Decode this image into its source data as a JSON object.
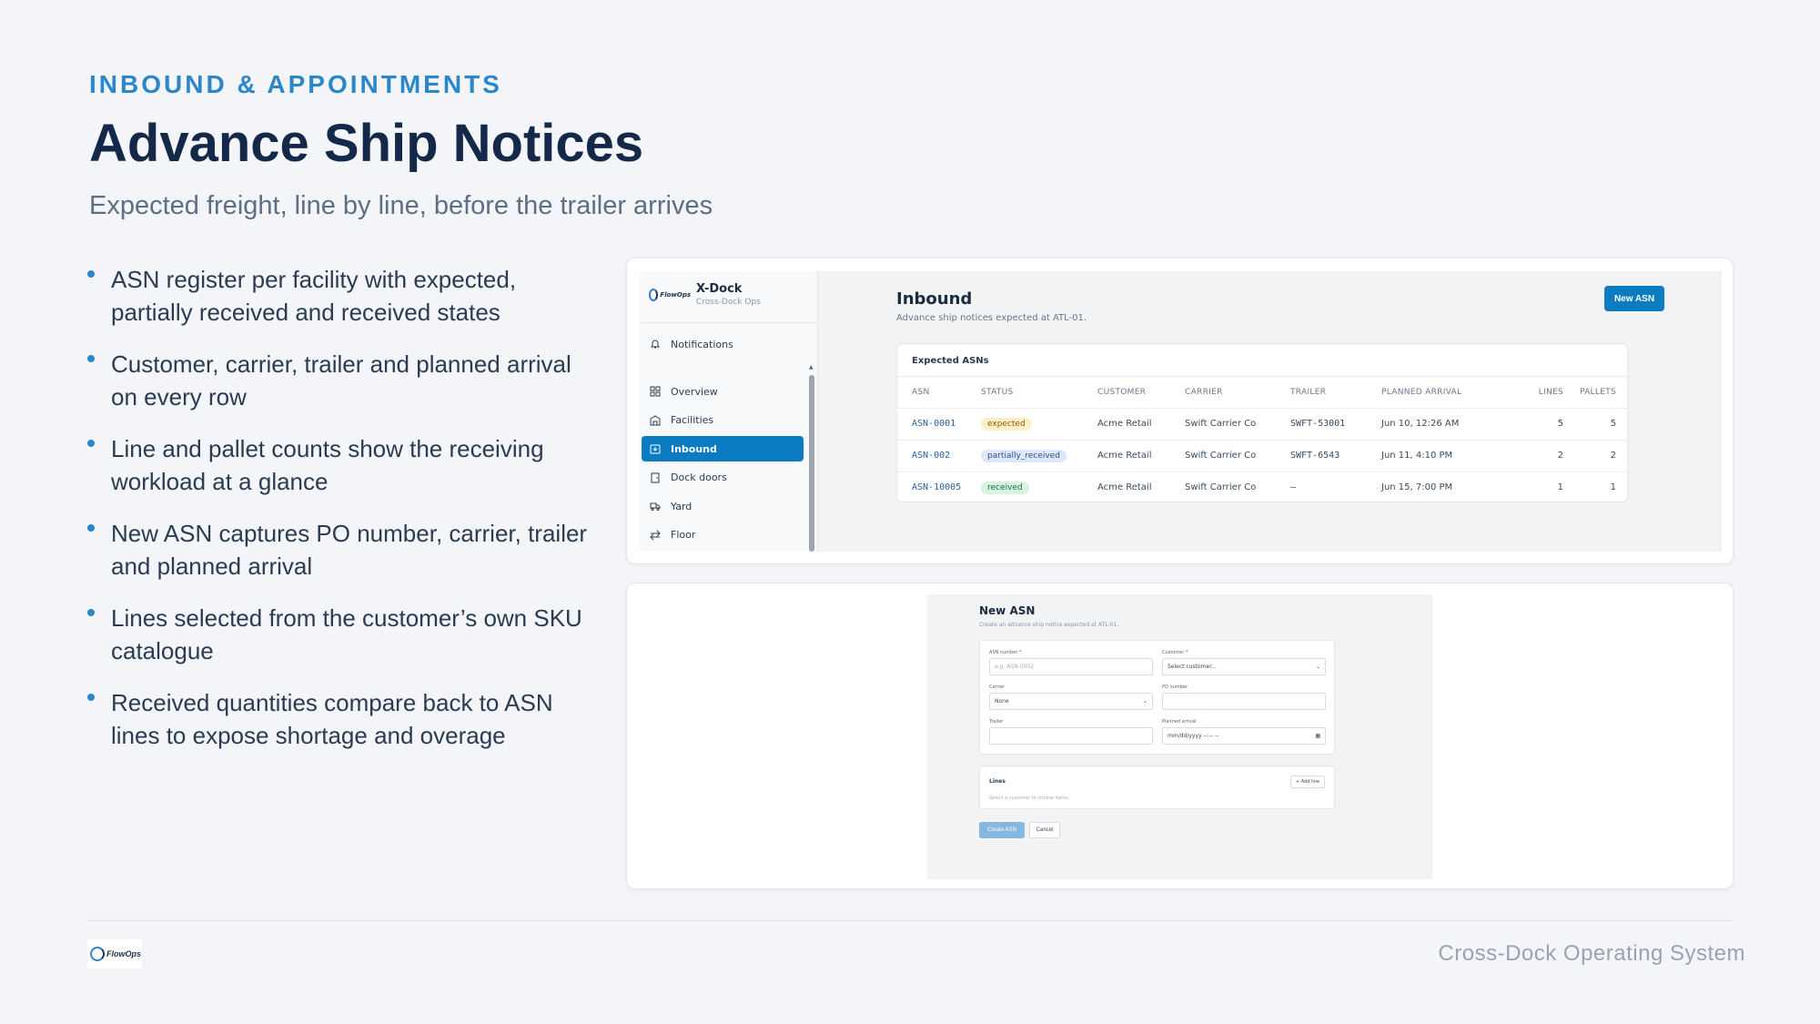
{
  "slide": {
    "eyebrow": "INBOUND & APPOINTMENTS",
    "title": "Advance Ship Notices",
    "subtitle": "Expected freight, line by line, before the trailer arrives",
    "bullets": [
      "ASN register per facility with expected, partially received and received states",
      "Customer, carrier, trailer and planned arrival on every row",
      "Line and pallet counts show the receiving workload at a glance",
      "New ASN captures PO number, carrier, trailer and planned arrival",
      "Lines selected from the customer’s own SKU catalogue",
      "Received quantities compare back to ASN lines to expose shortage and overage"
    ]
  },
  "app": {
    "logo_text": "FlowOps",
    "brand_name": "X-Dock",
    "brand_sub": "Cross-Dock Ops",
    "notifications_label": "Notifications",
    "nav": [
      {
        "label": "Overview",
        "icon": "grid-icon"
      },
      {
        "label": "Facilities",
        "icon": "building-icon"
      },
      {
        "label": "Inbound",
        "icon": "inbound-icon",
        "active": true
      },
      {
        "label": "Dock doors",
        "icon": "door-icon"
      },
      {
        "label": "Yard",
        "icon": "truck-icon"
      },
      {
        "label": "Floor",
        "icon": "arrows-icon"
      }
    ]
  },
  "inbound": {
    "title": "Inbound",
    "subtitle": "Advance ship notices expected at ATL-01.",
    "new_button": "New ASN",
    "table_title": "Expected ASNs",
    "columns": [
      "ASN",
      "STATUS",
      "CUSTOMER",
      "CARRIER",
      "TRAILER",
      "PLANNED ARRIVAL",
      "LINES",
      "PALLETS"
    ],
    "rows": [
      {
        "asn": "ASN-0001",
        "status": "expected",
        "customer": "Acme Retail",
        "carrier": "Swift Carrier Co",
        "trailer": "SWFT-53001",
        "arrival": "Jun 10, 12:26 AM",
        "lines": "5",
        "pallets": "5"
      },
      {
        "asn": "ASN-002",
        "status": "partially_received",
        "customer": "Acme Retail",
        "carrier": "Swift Carrier Co",
        "trailer": "SWFT-6543",
        "arrival": "Jun 11, 4:10 PM",
        "lines": "2",
        "pallets": "2"
      },
      {
        "asn": "ASN-10005",
        "status": "received",
        "customer": "Acme Retail",
        "carrier": "Swift Carrier Co",
        "trailer": "—",
        "arrival": "Jun 15, 7:00 PM",
        "lines": "1",
        "pallets": "1"
      }
    ],
    "status_colors": {
      "expected": "#fdf0c8",
      "partially_received": "#dde8fa",
      "received": "#d9f3e2"
    }
  },
  "new_asn": {
    "title": "New ASN",
    "subtitle": "Create an advance ship notice expected at ATL-01.",
    "asn_number_label": "ASN number *",
    "asn_number_placeholder": "e.g. ASN-0002",
    "customer_label": "Customer *",
    "customer_value": "Select customer...",
    "carrier_label": "Carrier",
    "carrier_value": "None",
    "po_label": "PO number",
    "trailer_label": "Trailer",
    "planned_label": "Planned arrival",
    "planned_value": "mm/dd/yyyy --:-- --",
    "lines_title": "Lines",
    "add_line": "+ Add line",
    "lines_help": "Select a customer to choose items.",
    "create_button": "Create ASN",
    "cancel_button": "Cancel"
  },
  "footer": {
    "logo_text": "FlowOps",
    "text": "Cross-Dock Operating System"
  },
  "colors": {
    "accent": "#2b87c9",
    "primary_button": "#0b7cc1",
    "title": "#14294a"
  }
}
